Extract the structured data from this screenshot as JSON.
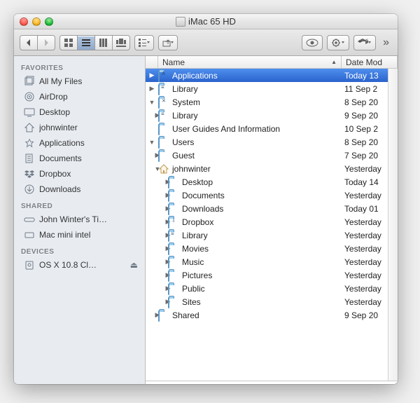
{
  "window": {
    "title": "iMac 65 HD"
  },
  "toolbar": {
    "view_modes": [
      "icon",
      "list",
      "column",
      "coverflow"
    ],
    "active_view": "list"
  },
  "sidebar": {
    "sections": [
      {
        "label": "FAVORITES",
        "items": [
          {
            "icon": "allfiles",
            "label": "All My Files"
          },
          {
            "icon": "airdrop",
            "label": "AirDrop"
          },
          {
            "icon": "desktop",
            "label": "Desktop"
          },
          {
            "icon": "home",
            "label": "johnwinter"
          },
          {
            "icon": "apps",
            "label": "Applications"
          },
          {
            "icon": "docs",
            "label": "Documents"
          },
          {
            "icon": "dropbox",
            "label": "Dropbox"
          },
          {
            "icon": "downloads",
            "label": "Downloads"
          }
        ]
      },
      {
        "label": "SHARED",
        "items": [
          {
            "icon": "timecapsule",
            "label": "John Winter's Ti…"
          },
          {
            "icon": "macmini",
            "label": "Mac mini intel"
          }
        ]
      },
      {
        "label": "DEVICES",
        "items": [
          {
            "icon": "disk",
            "label": "OS X 10.8 Cl…",
            "eject": true
          }
        ]
      }
    ]
  },
  "columns": {
    "name": "Name",
    "date": "Date Mod"
  },
  "rows": [
    {
      "indent": 0,
      "tri": "▶",
      "icon": "app",
      "name": "Applications",
      "date": "Today 13",
      "selected": true
    },
    {
      "indent": 0,
      "tri": "▶",
      "icon": "lib",
      "name": "Library",
      "date": "11 Sep 2",
      "arrow": true,
      "arrowWidth": 50
    },
    {
      "indent": 0,
      "tri": "▼",
      "icon": "sys",
      "name": "System",
      "date": "8 Sep 20"
    },
    {
      "indent": 1,
      "tri": "▶",
      "icon": "lib",
      "name": "Library",
      "date": "9 Sep 20",
      "arrow": true,
      "arrowWidth": 34
    },
    {
      "indent": 0,
      "tri": "",
      "icon": "folder",
      "name": "User Guides And Information",
      "date": "10 Sep 2"
    },
    {
      "indent": 0,
      "tri": "▼",
      "icon": "folder",
      "name": "Users",
      "date": "8 Sep 20"
    },
    {
      "indent": 1,
      "tri": "▶",
      "icon": "folder",
      "name": "Guest",
      "date": "7 Sep 20"
    },
    {
      "indent": 1,
      "tri": "▼",
      "icon": "home",
      "name": "johnwinter",
      "date": "Yesterday"
    },
    {
      "indent": 2,
      "tri": "▶",
      "icon": "folder",
      "name": "Desktop",
      "date": "Today 14"
    },
    {
      "indent": 2,
      "tri": "▶",
      "icon": "folder",
      "name": "Documents",
      "date": "Yesterday"
    },
    {
      "indent": 2,
      "tri": "▶",
      "icon": "folder",
      "name": "Downloads",
      "date": "Today 01"
    },
    {
      "indent": 2,
      "tri": "▶",
      "icon": "drop",
      "name": "Dropbox",
      "date": "Yesterday"
    },
    {
      "indent": 2,
      "tri": "▶",
      "icon": "lib",
      "name": "Library",
      "date": "Yesterday",
      "arrow": true,
      "arrowWidth": 20
    },
    {
      "indent": 2,
      "tri": "▶",
      "icon": "folder",
      "name": "Movies",
      "date": "Yesterday"
    },
    {
      "indent": 2,
      "tri": "▶",
      "icon": "folder",
      "name": "Music",
      "date": "Yesterday"
    },
    {
      "indent": 2,
      "tri": "▶",
      "icon": "folder",
      "name": "Pictures",
      "date": "Yesterday"
    },
    {
      "indent": 2,
      "tri": "▶",
      "icon": "folder",
      "name": "Public",
      "date": "Yesterday"
    },
    {
      "indent": 2,
      "tri": "▶",
      "icon": "folder",
      "name": "Sites",
      "date": "Yesterday"
    },
    {
      "indent": 1,
      "tri": "▶",
      "icon": "folder",
      "name": "Shared",
      "date": "9 Sep 20"
    }
  ]
}
